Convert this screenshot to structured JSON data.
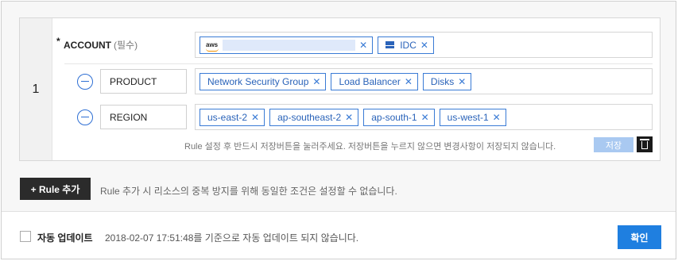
{
  "rule": {
    "number": "1",
    "account": {
      "label": "ACCOUNT",
      "required_mark": "*",
      "required_text": "(필수)",
      "tags": [
        {
          "icon": "aws-logo",
          "logo_text": "aws",
          "value_masked": true
        },
        {
          "icon": "server-icon",
          "label": "IDC"
        }
      ]
    },
    "conditions": [
      {
        "key": "PRODUCT",
        "values": [
          "Network Security Group",
          "Load Balancer",
          "Disks"
        ]
      },
      {
        "key": "REGION",
        "values": [
          "us-east-2",
          "ap-southeast-2",
          "ap-south-1",
          "us-west-1"
        ]
      }
    ],
    "save_hint": "Rule 설정 후 반드시 저장버튼을 눌러주세요. 저장버튼을 누르지 않으면 변경사항이 저장되지 않습니다.",
    "save_label": "저장",
    "tag_remove_glyph": "✕"
  },
  "add_rule": {
    "label": "+ Rule 추가",
    "note": "Rule 추가 시 리소스의 중복 방지를 위해 동일한 조건은 설정할 수 없습니다."
  },
  "footer": {
    "auto_update_label": "자동 업데이트",
    "auto_update_checked": false,
    "auto_update_note": "2018-02-07 17:51:48를 기준으로 자동 업데이트 되지 않습니다.",
    "confirm_label": "확인"
  },
  "colors": {
    "tag_border": "#3a7bd5",
    "primary_button": "#1f7fe0",
    "disabled_save": "#a9c9f1",
    "dark_button": "#2b2b2b"
  }
}
